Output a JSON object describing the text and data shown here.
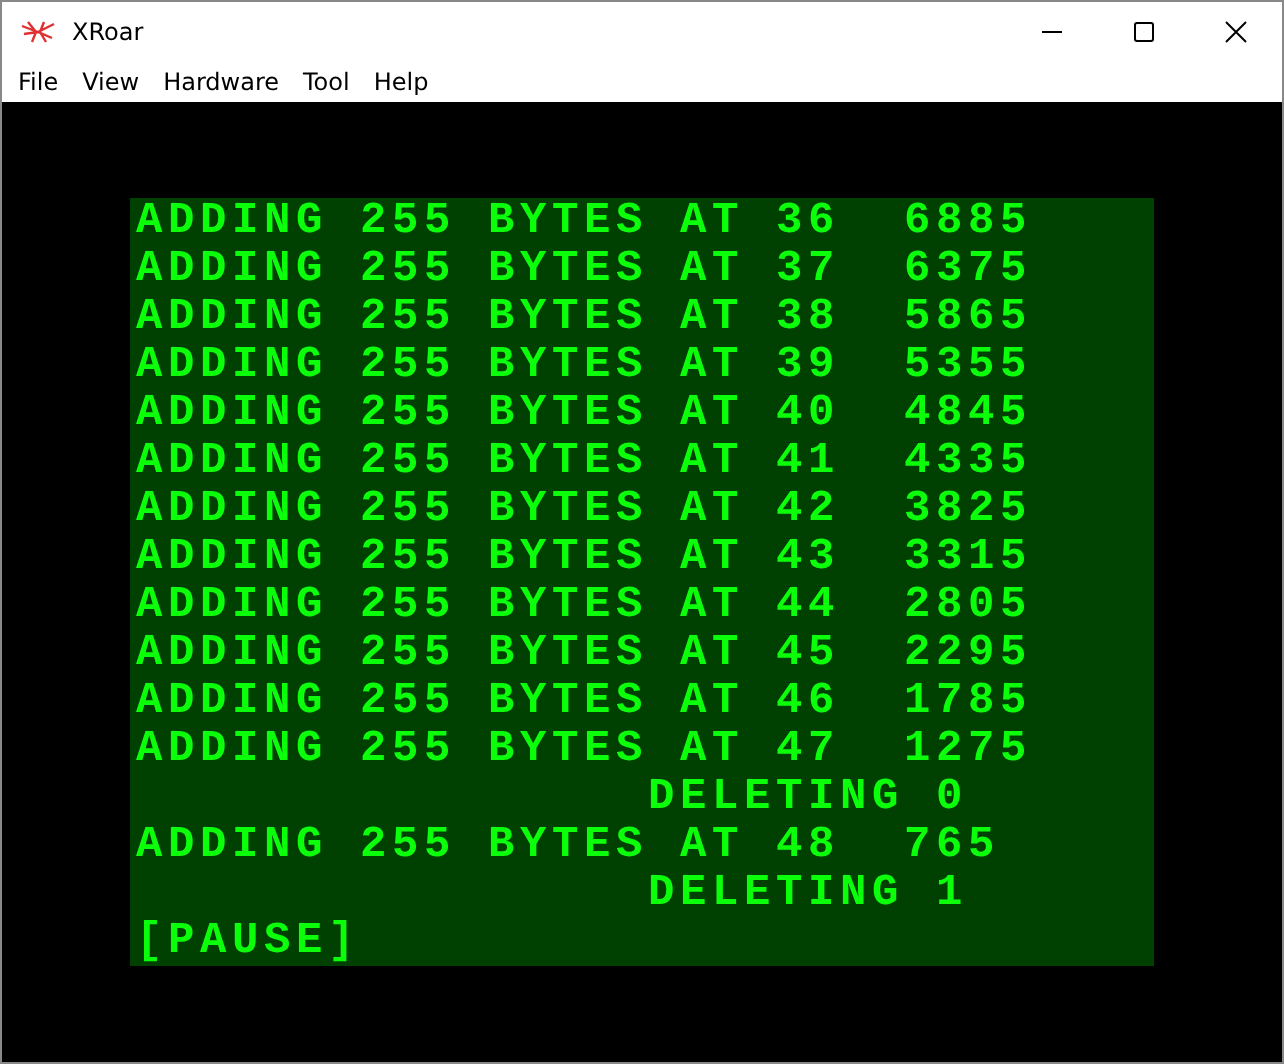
{
  "window": {
    "title": "XRoar"
  },
  "menu": [
    "File",
    "View",
    "Hardware",
    "Tool",
    "Help"
  ],
  "screen": {
    "lines": [
      "ADDING 255 BYTES AT 36  6885",
      "ADDING 255 BYTES AT 37  6375",
      "ADDING 255 BYTES AT 38  5865",
      "ADDING 255 BYTES AT 39  5355",
      "ADDING 255 BYTES AT 40  4845",
      "ADDING 255 BYTES AT 41  4335",
      "ADDING 255 BYTES AT 42  3825",
      "ADDING 255 BYTES AT 43  3315",
      "ADDING 255 BYTES AT 44  2805",
      "ADDING 255 BYTES AT 45  2295",
      "ADDING 255 BYTES AT 46  1785",
      "ADDING 255 BYTES AT 47  1275",
      "                DELETING 0",
      "ADDING 255 BYTES AT 48  765",
      "                DELETING 1",
      "[PAUSE]"
    ]
  }
}
